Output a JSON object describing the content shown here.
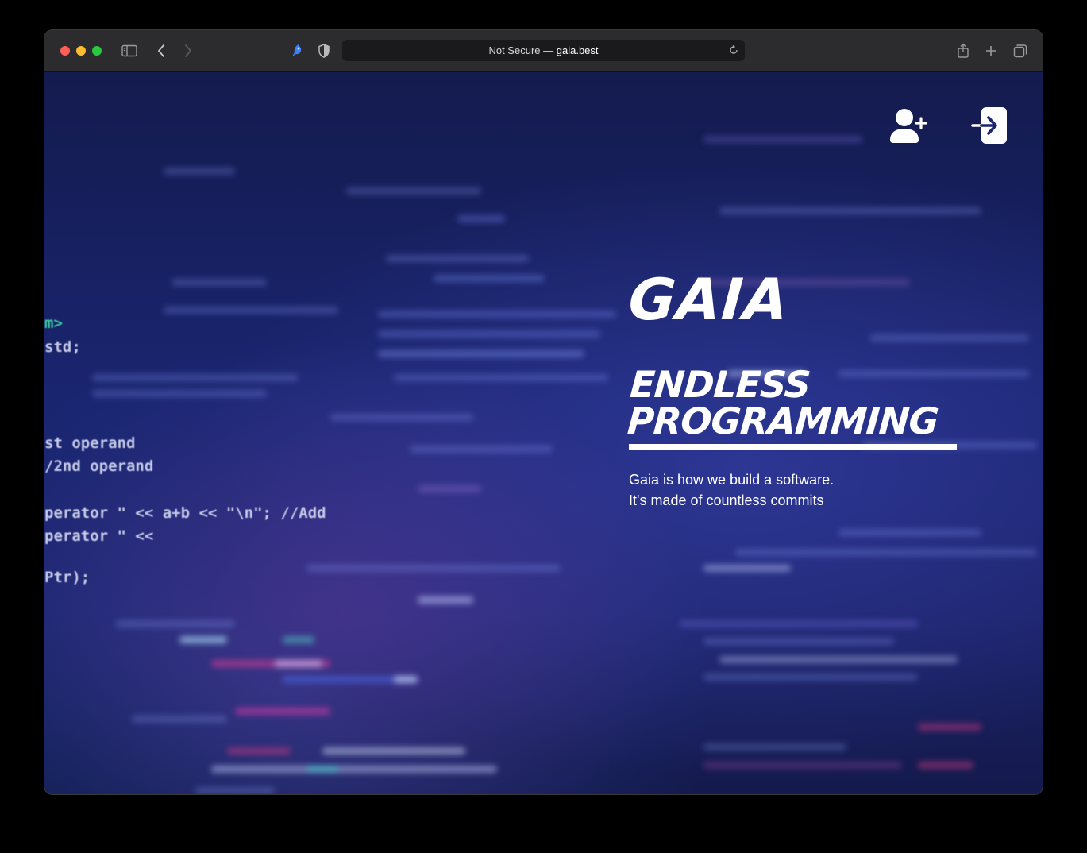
{
  "browser": {
    "url_prefix": "Not Secure —",
    "url_domain": "gaia.best",
    "icons": {
      "sidebar": "sidebar-icon",
      "back": "chevron-left-icon",
      "forward": "chevron-right-icon",
      "extension": "extension-icon",
      "privacy": "shield-icon",
      "reload": "reload-icon",
      "share": "share-icon",
      "new_tab": "plus-icon",
      "tabs": "tabs-overview-icon"
    },
    "traffic_colors": {
      "close": "#ff5f57",
      "minimize": "#febc2e",
      "zoom": "#28c840"
    }
  },
  "page": {
    "header_icons": {
      "register": "add-user-icon",
      "login": "login-icon"
    },
    "hero": {
      "title": "GAIA",
      "subtitle_line1": "ENDLESS",
      "subtitle_line2": "PROGRAMMING",
      "desc_line1": "Gaia is how we build a software.",
      "desc_line2": "It's made of countless commits"
    },
    "background_code": [
      "m>",
      "std;",
      "st operand",
      "/2nd operand",
      "perator \" << a+b << \"\\n\"; //Add",
      "perator \" <<",
      "Ptr);"
    ]
  }
}
